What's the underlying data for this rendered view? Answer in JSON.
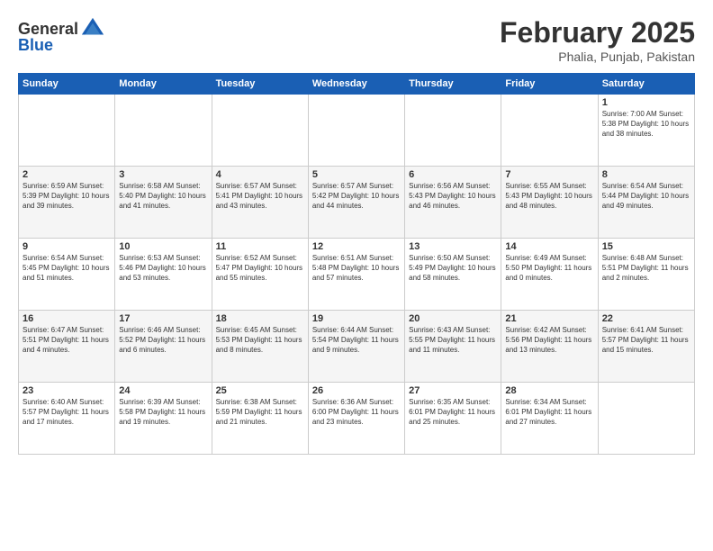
{
  "header": {
    "logo_general": "General",
    "logo_blue": "Blue",
    "month_year": "February 2025",
    "location": "Phalia, Punjab, Pakistan"
  },
  "weekdays": [
    "Sunday",
    "Monday",
    "Tuesday",
    "Wednesday",
    "Thursday",
    "Friday",
    "Saturday"
  ],
  "weeks": [
    [
      {
        "day": "",
        "content": ""
      },
      {
        "day": "",
        "content": ""
      },
      {
        "day": "",
        "content": ""
      },
      {
        "day": "",
        "content": ""
      },
      {
        "day": "",
        "content": ""
      },
      {
        "day": "",
        "content": ""
      },
      {
        "day": "1",
        "content": "Sunrise: 7:00 AM\nSunset: 5:38 PM\nDaylight: 10 hours and 38 minutes."
      }
    ],
    [
      {
        "day": "2",
        "content": "Sunrise: 6:59 AM\nSunset: 5:39 PM\nDaylight: 10 hours and 39 minutes."
      },
      {
        "day": "3",
        "content": "Sunrise: 6:58 AM\nSunset: 5:40 PM\nDaylight: 10 hours and 41 minutes."
      },
      {
        "day": "4",
        "content": "Sunrise: 6:57 AM\nSunset: 5:41 PM\nDaylight: 10 hours and 43 minutes."
      },
      {
        "day": "5",
        "content": "Sunrise: 6:57 AM\nSunset: 5:42 PM\nDaylight: 10 hours and 44 minutes."
      },
      {
        "day": "6",
        "content": "Sunrise: 6:56 AM\nSunset: 5:43 PM\nDaylight: 10 hours and 46 minutes."
      },
      {
        "day": "7",
        "content": "Sunrise: 6:55 AM\nSunset: 5:43 PM\nDaylight: 10 hours and 48 minutes."
      },
      {
        "day": "8",
        "content": "Sunrise: 6:54 AM\nSunset: 5:44 PM\nDaylight: 10 hours and 49 minutes."
      }
    ],
    [
      {
        "day": "9",
        "content": "Sunrise: 6:54 AM\nSunset: 5:45 PM\nDaylight: 10 hours and 51 minutes."
      },
      {
        "day": "10",
        "content": "Sunrise: 6:53 AM\nSunset: 5:46 PM\nDaylight: 10 hours and 53 minutes."
      },
      {
        "day": "11",
        "content": "Sunrise: 6:52 AM\nSunset: 5:47 PM\nDaylight: 10 hours and 55 minutes."
      },
      {
        "day": "12",
        "content": "Sunrise: 6:51 AM\nSunset: 5:48 PM\nDaylight: 10 hours and 57 minutes."
      },
      {
        "day": "13",
        "content": "Sunrise: 6:50 AM\nSunset: 5:49 PM\nDaylight: 10 hours and 58 minutes."
      },
      {
        "day": "14",
        "content": "Sunrise: 6:49 AM\nSunset: 5:50 PM\nDaylight: 11 hours and 0 minutes."
      },
      {
        "day": "15",
        "content": "Sunrise: 6:48 AM\nSunset: 5:51 PM\nDaylight: 11 hours and 2 minutes."
      }
    ],
    [
      {
        "day": "16",
        "content": "Sunrise: 6:47 AM\nSunset: 5:51 PM\nDaylight: 11 hours and 4 minutes."
      },
      {
        "day": "17",
        "content": "Sunrise: 6:46 AM\nSunset: 5:52 PM\nDaylight: 11 hours and 6 minutes."
      },
      {
        "day": "18",
        "content": "Sunrise: 6:45 AM\nSunset: 5:53 PM\nDaylight: 11 hours and 8 minutes."
      },
      {
        "day": "19",
        "content": "Sunrise: 6:44 AM\nSunset: 5:54 PM\nDaylight: 11 hours and 9 minutes."
      },
      {
        "day": "20",
        "content": "Sunrise: 6:43 AM\nSunset: 5:55 PM\nDaylight: 11 hours and 11 minutes."
      },
      {
        "day": "21",
        "content": "Sunrise: 6:42 AM\nSunset: 5:56 PM\nDaylight: 11 hours and 13 minutes."
      },
      {
        "day": "22",
        "content": "Sunrise: 6:41 AM\nSunset: 5:57 PM\nDaylight: 11 hours and 15 minutes."
      }
    ],
    [
      {
        "day": "23",
        "content": "Sunrise: 6:40 AM\nSunset: 5:57 PM\nDaylight: 11 hours and 17 minutes."
      },
      {
        "day": "24",
        "content": "Sunrise: 6:39 AM\nSunset: 5:58 PM\nDaylight: 11 hours and 19 minutes."
      },
      {
        "day": "25",
        "content": "Sunrise: 6:38 AM\nSunset: 5:59 PM\nDaylight: 11 hours and 21 minutes."
      },
      {
        "day": "26",
        "content": "Sunrise: 6:36 AM\nSunset: 6:00 PM\nDaylight: 11 hours and 23 minutes."
      },
      {
        "day": "27",
        "content": "Sunrise: 6:35 AM\nSunset: 6:01 PM\nDaylight: 11 hours and 25 minutes."
      },
      {
        "day": "28",
        "content": "Sunrise: 6:34 AM\nSunset: 6:01 PM\nDaylight: 11 hours and 27 minutes."
      },
      {
        "day": "",
        "content": ""
      }
    ]
  ]
}
